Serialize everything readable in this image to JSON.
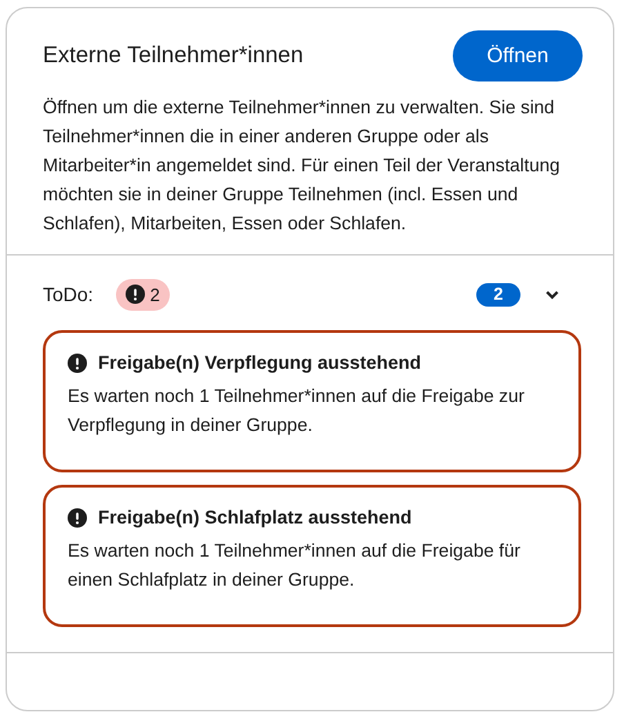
{
  "card": {
    "title": "Externe Teilnehmer*innen",
    "button": "Öffnen",
    "description": "Öffnen um die externe Teilnehmer*innen zu verwalten. Sie sind Teilnehmer*innen die in einer anderen Gruppe oder als Mitarbeiter*in angemeldet sind. Für einen Teil der Veranstaltung möchten sie in deiner Gruppe Teilnehmen (incl. Essen und Schlafen), Mitarbeiten, Essen oder Schlafen."
  },
  "todo": {
    "label": "ToDo:",
    "alert_count": "2",
    "count": "2",
    "expanded": true,
    "alerts": [
      {
        "title": "Freigabe(n) Verpflegung ausstehend",
        "text": "Es warten noch 1 Teilnehmer*innen auf die Freigabe zur Verpflegung in deiner Gruppe."
      },
      {
        "title": "Freigabe(n) Schlafplatz ausstehend",
        "text": "Es warten noch 1 Teilnehmer*innen auf die Freigabe für einen Schlafplatz in deiner Gruppe."
      }
    ]
  }
}
